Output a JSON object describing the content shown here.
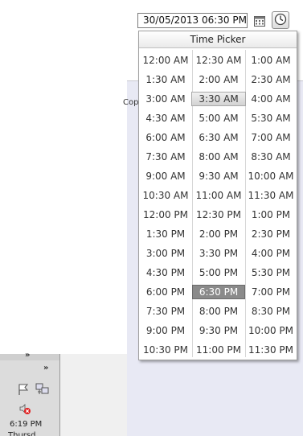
{
  "datetime_input": {
    "value": "30/05/2013 06:30 PM"
  },
  "time_picker": {
    "title": "Time Picker",
    "selected": "6:30 PM",
    "highlighted": "3:30 AM",
    "times": [
      "12:00 AM",
      "12:30 AM",
      "1:00 AM",
      "1:30 AM",
      "2:00 AM",
      "2:30 AM",
      "3:00 AM",
      "3:30 AM",
      "4:00 AM",
      "4:30 AM",
      "5:00 AM",
      "5:30 AM",
      "6:00 AM",
      "6:30 AM",
      "7:00 AM",
      "7:30 AM",
      "8:00 AM",
      "8:30 AM",
      "9:00 AM",
      "9:30 AM",
      "10:00 AM",
      "10:30 AM",
      "11:00 AM",
      "11:30 AM",
      "12:00 PM",
      "12:30 PM",
      "1:00 PM",
      "1:30 PM",
      "2:00 PM",
      "2:30 PM",
      "3:00 PM",
      "3:30 PM",
      "4:00 PM",
      "4:30 PM",
      "5:00 PM",
      "5:30 PM",
      "6:00 PM",
      "6:30 PM",
      "7:00 PM",
      "7:30 PM",
      "8:00 PM",
      "8:30 PM",
      "9:00 PM",
      "9:30 PM",
      "10:00 PM",
      "10:30 PM",
      "11:00 PM",
      "11:30 PM"
    ]
  },
  "background": {
    "partial_text": "Cop"
  },
  "taskbar": {
    "chevron_top": "»",
    "chevron_tray": "»",
    "clock_time": "6:19 PM",
    "clock_date_partial": "Thursd"
  },
  "icons": {
    "calendar": "calendar-icon",
    "clock": "clock-icon",
    "flag": "flag-icon",
    "network": "network-icon",
    "volume": "volume-muted-icon"
  },
  "colors": {
    "selected_bg": "#8a8a8a",
    "hover_bg": "#d8d8d8",
    "panel_bg": "#e8e9f4"
  }
}
